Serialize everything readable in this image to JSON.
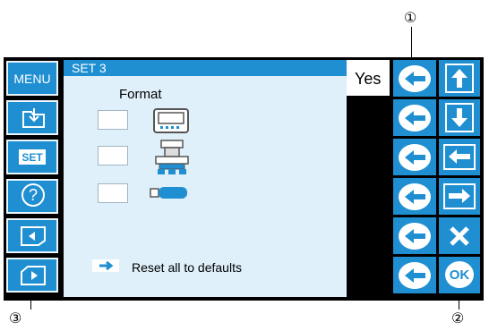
{
  "callouts": {
    "one": "①",
    "two": "②",
    "three": "③"
  },
  "left_buttons": {
    "menu": "MENU",
    "set": "SET",
    "help": "?"
  },
  "screen": {
    "title": "SET 3",
    "confirm_label": "Yes",
    "format_heading": "Format",
    "reset_label": "Reset all to defaults"
  },
  "right_buttons": {
    "ok": "OK"
  },
  "colors": {
    "button_blue": "#1f8fd2",
    "screen_bg": "#dff0fa",
    "panel": "#000000"
  },
  "icons": [
    "menu-icon",
    "folder-open-icon",
    "set-icon",
    "help-icon",
    "previous-page-icon",
    "next-page-icon",
    "back-arrow-icon",
    "up-arrow-icon",
    "down-arrow-icon",
    "left-arrow-icon",
    "right-arrow-icon",
    "close-icon",
    "ok-icon",
    "lcd-display-icon",
    "embroidery-machine-icon",
    "usb-drive-icon"
  ]
}
